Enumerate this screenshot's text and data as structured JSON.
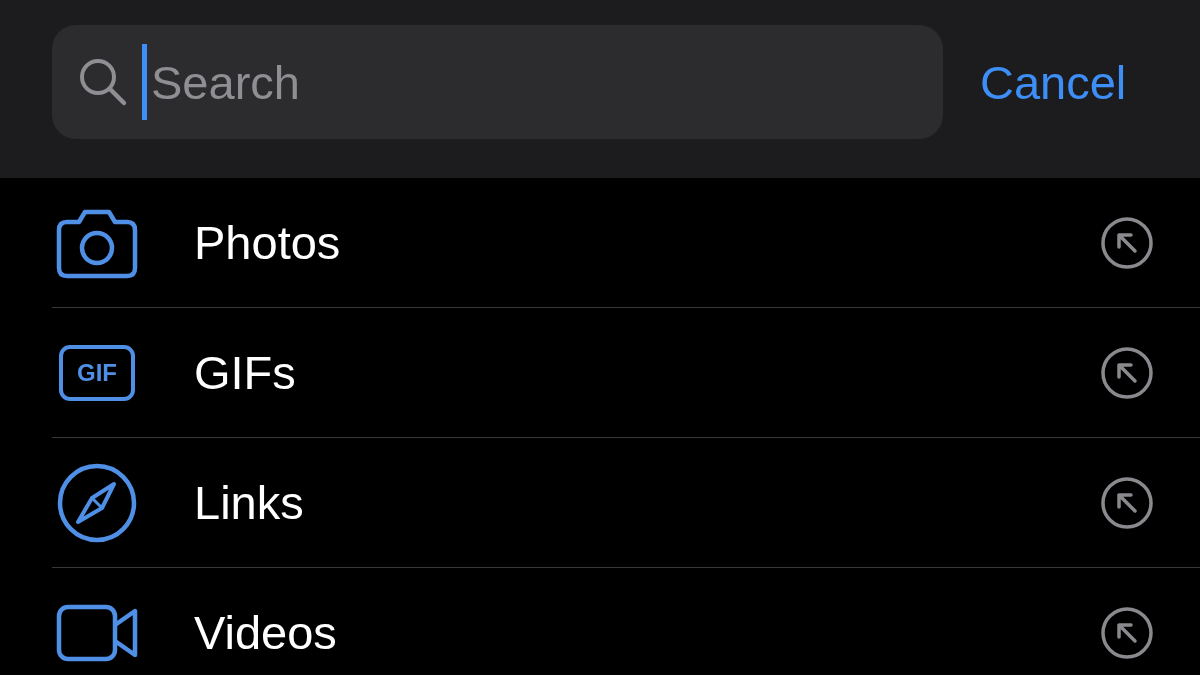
{
  "search": {
    "placeholder": "Search",
    "focused": true
  },
  "cancel": "Cancel",
  "items": [
    {
      "kind": "camera",
      "label": "Photos"
    },
    {
      "kind": "gif",
      "label": "GIFs",
      "icon_text": "GIF"
    },
    {
      "kind": "compass",
      "label": "Links"
    },
    {
      "kind": "video",
      "label": "Videos"
    }
  ]
}
